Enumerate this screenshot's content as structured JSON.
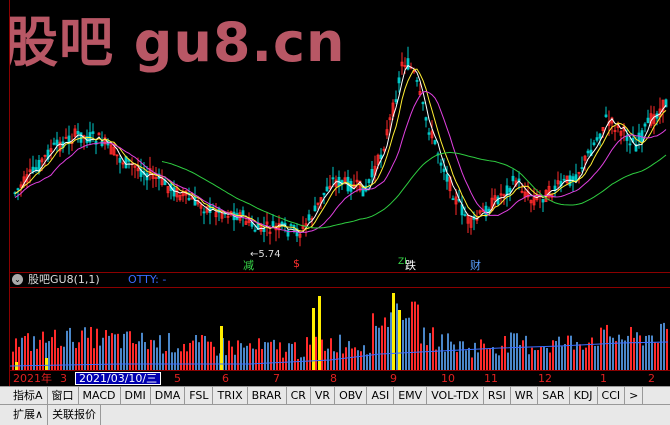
{
  "watermark": "股吧 gu8.cn",
  "main": {
    "low_marker": "←5.74",
    "events": [
      {
        "label": "减",
        "color": "#39d94a"
      },
      {
        "label": "$",
        "color": "#ff3030"
      },
      {
        "label": "ZI",
        "color": "#39d94a"
      },
      {
        "label": "跌",
        "color": "#ffffff"
      },
      {
        "label": "财",
        "color": "#5aa0ff"
      }
    ]
  },
  "sub_panel": {
    "title": "股吧GU8(1,1)",
    "indicator": "OTTY: -"
  },
  "date_axis": {
    "year": "2021年",
    "selected_date": "2021/03/10/三",
    "months": [
      "3",
      "5",
      "6",
      "7",
      "8",
      "9",
      "10",
      "11",
      "12",
      "1",
      "2"
    ]
  },
  "tabs": [
    "指标A",
    "窗口",
    "MACD",
    "DMI",
    "DMA",
    "FSL",
    "TRIX",
    "BRAR",
    "CR",
    "VR",
    "OBV",
    "ASI",
    "EMV",
    "VOL-TDX",
    "RSI",
    "WR",
    "SAR",
    "KDJ",
    "CCI",
    ">"
  ],
  "bottom_buttons": [
    "扩展∧",
    "关联报价"
  ],
  "colors": {
    "up": "#ff2a2a",
    "down": "#00c8c8",
    "ma5": "#ffffff",
    "ma10": "#ffee33",
    "ma20": "#e040e0",
    "ma60": "#2ecc40",
    "vol_line": "#3a6cff",
    "yellow_bar": "#ffee00"
  }
}
